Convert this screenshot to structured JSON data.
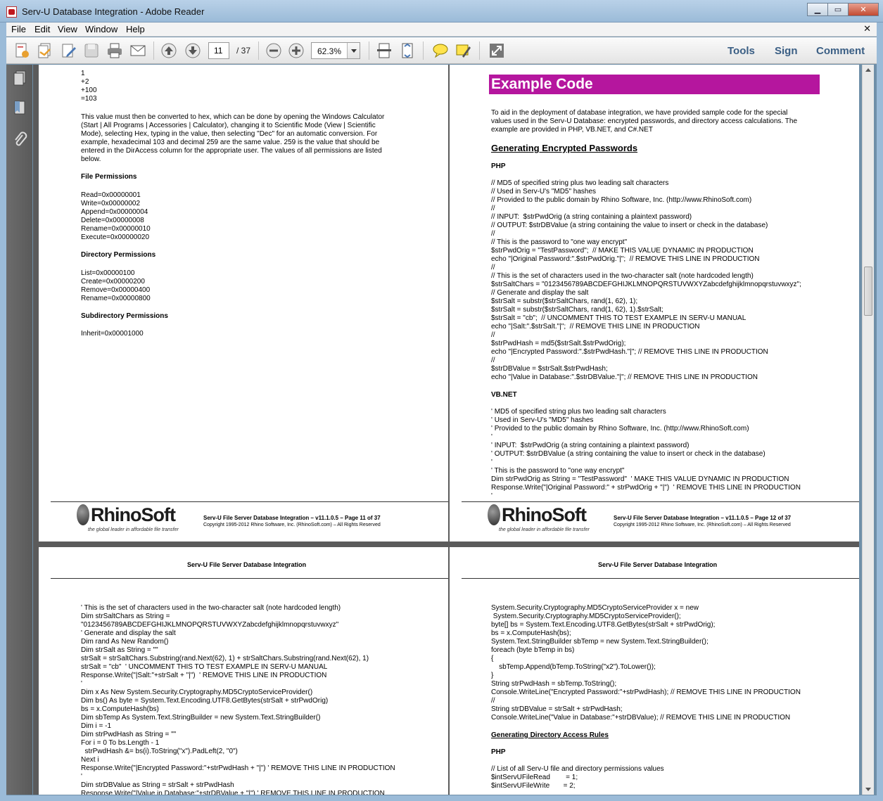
{
  "window": {
    "title": "Serv-U Database Integration - Adobe Reader"
  },
  "menu": [
    "File",
    "Edit",
    "View",
    "Window",
    "Help"
  ],
  "toolbar": {
    "page_current": "11",
    "page_total": "/ 37",
    "zoom": "62.3%",
    "tools_label": "Tools",
    "sign_label": "Sign",
    "comment_label": "Comment"
  },
  "page11": {
    "calc_lines": "1\n+2\n+100\n=103",
    "paragraph": "This value must then be converted to hex, which can be done by opening the Windows Calculator\n(Start | All Programs | Accessories | Calculator), changing it to Scientific Mode (View | Scientific\nMode), selecting Hex, typing in the value, then selecting \"Dec\" for an automatic conversion. For\nexample, hexadecimal 103 and decimal 259 are the same value. 259 is the value that should be\nentered in the DirAccess column for the appropriate user. The values of all permissions are listed\nbelow.",
    "file_perm_head": "File Permissions",
    "file_perms": "Read=0x00000001\nWrite=0x00000002\nAppend=0x00000004\nDelete=0x00000008\nRename=0x00000010\nExecute=0x00000020",
    "dir_perm_head": "Directory Permissions",
    "dir_perms": "List=0x00000100\nCreate=0x00000200\nRemove=0x00000400\nRename=0x00000800",
    "subdir_perm_head": "Subdirectory Permissions",
    "subdir_perms": "Inherit=0x00001000",
    "footer_title": "Serv-U File Server Database Integration – v11.1.0.5 – Page 11 of 37",
    "footer_copy": "Copyright 1995-2012 Rhino Software, Inc. (RhinoSoft.com) – All Rights Reserved"
  },
  "page12": {
    "banner": "Example Code",
    "intro": "To aid in the deployment of database integration, we have provided sample code for the special\nvalues used in the Serv-U Database: encrypted passwords, and directory access calculations. The\nexample are provided in PHP, VB.NET, and C#.NET",
    "h_encrypted": "Generating Encrypted Passwords",
    "php_head": "PHP",
    "php_code": "// MD5 of specified string plus two leading salt characters\n// Used in Serv-U's \"MD5\" hashes\n// Provided to the public domain by Rhino Software, Inc. (http://www.RhinoSoft.com)\n//\n// INPUT:  $strPwdOrig (a string containing a plaintext password)\n// OUTPUT: $strDBValue (a string containing the value to insert or check in the database)\n//\n// This is the password to \"one way encrypt\"\n$strPwdOrig = \"TestPassword\";  // MAKE THIS VALUE DYNAMIC IN PRODUCTION\necho \"|Original Password:\".$strPwdOrig.\"|\";  // REMOVE THIS LINE IN PRODUCTION\n//\n// This is the set of characters used in the two-character salt (note hardcoded length)\n$strSaltChars = \"0123456789ABCDEFGHIJKLMNOPQRSTUVWXYZabcdefghijklmnopqrstuvwxyz\";\n// Generate and display the salt\n$strSalt = substr($strSaltChars, rand(1, 62), 1);\n$strSalt = substr($strSaltChars, rand(1, 62), 1).$strSalt;\n$strSalt = \"cb\";  // UNCOMMENT THIS TO TEST EXAMPLE IN SERV-U MANUAL\necho \"|Salt:\".$strSalt.\"|\";  // REMOVE THIS LINE IN PRODUCTION\n//\n$strPwdHash = md5($strSalt.$strPwdOrig);\necho \"|Encrypted Password:\".$strPwdHash.\"|\"; // REMOVE THIS LINE IN PRODUCTION\n//\n$strDBValue = $strSalt.$strPwdHash;\necho \"|Value in Database:\".$strDBValue.\"|\"; // REMOVE THIS LINE IN PRODUCTION",
    "vb_head": "VB.NET",
    "vb_code": "' MD5 of specified string plus two leading salt characters\n' Used in Serv-U's \"MD5\" hashes\n' Provided to the public domain by Rhino Software, Inc. (http://www.RhinoSoft.com)\n'\n' INPUT:  $strPwdOrig (a string containing a plaintext password)\n' OUTPUT: $strDBValue (a string containing the value to insert or check in the database)\n'\n' This is the password to \"one way encrypt\"\nDim strPwdOrig as String = \"TestPassword\"  ' MAKE THIS VALUE DYNAMIC IN PRODUCTION\nResponse.Write(\"|Original Password:\" + strPwdOrig + \"|\")  ' REMOVE THIS LINE IN PRODUCTION\n'",
    "footer_title": "Serv-U File Server Database Integration – v11.1.0.5 – Page 12 of 37",
    "footer_copy": "Copyright 1995-2012 Rhino Software, Inc. (RhinoSoft.com) – All Rights Reserved"
  },
  "page13": {
    "header": "Serv-U File Server Database Integration",
    "code": "' This is the set of characters used in the two-character salt (note hardcoded length)\nDim strSaltChars as String =\n\"0123456789ABCDEFGHIJKLMNOPQRSTUVWXYZabcdefghijklmnopqrstuvwxyz\"\n' Generate and display the salt\nDim rand As New Random()\nDim strSalt as String = \"\"\nstrSalt = strSaltChars.Substring(rand.Next(62), 1) + strSaltChars.Substring(rand.Next(62), 1)\nstrSalt = \"cb\"  ' UNCOMMENT THIS TO TEST EXAMPLE IN SERV-U MANUAL\nResponse.Write(\"|Salt:\"+strSalt + \"|\")  ' REMOVE THIS LINE IN PRODUCTION\n'\nDim x As New System.Security.Cryptography.MD5CryptoServiceProvider()\nDim bs() As byte = System.Text.Encoding.UTF8.GetBytes(strSalt + strPwdOrig)\nbs = x.ComputeHash(bs)\nDim sbTemp As System.Text.StringBuilder = new System.Text.StringBuilder()\nDim i = -1\nDim strPwdHash as String = \"\"\nFor i = 0 To bs.Length - 1\n  strPwdHash &= bs(i).ToString(\"x\").PadLeft(2, \"0\")\nNext i\nResponse.Write(\"|Encrypted Password:\"+strPwdHash + \"|\") ' REMOVE THIS LINE IN PRODUCTION\n'\nDim strDBValue as String = strSalt + strPwdHash\nResponse.Write(\"|Value in Database:\"+strDBValue + \"|\") ' REMOVE THIS LINE IN PRODUCTION"
  },
  "page14": {
    "header": "Serv-U File Server Database Integration",
    "code": "System.Security.Cryptography.MD5CryptoServiceProvider x = new\n System.Security.Cryptography.MD5CryptoServiceProvider();\nbyte[] bs = System.Text.Encoding.UTF8.GetBytes(strSalt + strPwdOrig);\nbs = x.ComputeHash(bs);\nSystem.Text.StringBuilder sbTemp = new System.Text.StringBuilder();\nforeach (byte bTemp in bs)\n{\n    sbTemp.Append(bTemp.ToString(\"x2\").ToLower());\n}\nString strPwdHash = sbTemp.ToString();\nConsole.WriteLine(\"Encrypted Password:\"+strPwdHash); // REMOVE THIS LINE IN PRODUCTION\n//\nString strDBValue = strSalt + strPwdHash;\nConsole.WriteLine(\"Value in Database:\"+strDBValue); // REMOVE THIS LINE IN PRODUCTION",
    "h_dir": "Generating Directory Access Rules",
    "php_head": "PHP",
    "php_code": "// List of all Serv-U file and directory permissions values\n$intServUFileRead        = 1;\n$intServUFileWrite       = 2;"
  },
  "logo": {
    "word": "RhinoSoft",
    "tagline": "the global leader in affordable file transfer"
  }
}
